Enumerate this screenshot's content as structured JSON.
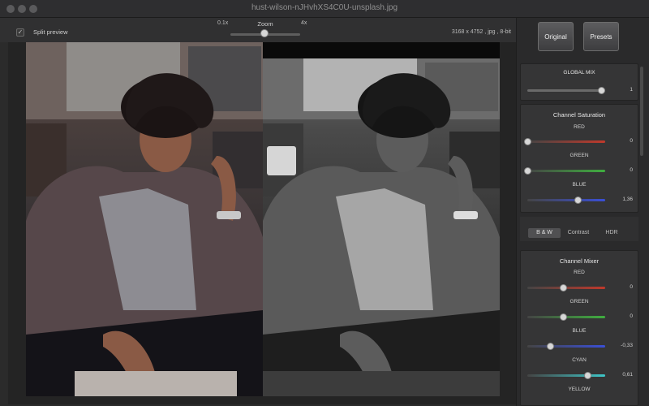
{
  "window": {
    "title": "hust-wilson-nJHvhXS4C0U-unsplash.jpg"
  },
  "toolbar": {
    "split_preview_label": "Split preview",
    "split_preview_checked": true,
    "zoom_label": "Zoom",
    "zoom_min": "0.1x",
    "zoom_max": "4x",
    "image_info": "3168 x 4752 , jpg , 8-bit"
  },
  "sidebar": {
    "original_label": "Original",
    "presets_label": "Presets",
    "global_mix": {
      "title": "GLOBAL MIX",
      "value": "1"
    },
    "channel_saturation": {
      "title": "Channel Saturation",
      "channels": [
        {
          "label": "RED",
          "value": "0"
        },
        {
          "label": "GREEN",
          "value": "0"
        },
        {
          "label": "BLUE",
          "value": "1,36"
        }
      ]
    },
    "modes": [
      "B & W",
      "Contrast",
      "HDR"
    ],
    "channel_mixer": {
      "title": "Channel Mixer",
      "channels": [
        {
          "label": "RED",
          "value": "0"
        },
        {
          "label": "GREEN",
          "value": "0"
        },
        {
          "label": "BLUE",
          "value": "-0,33"
        },
        {
          "label": "CYAN",
          "value": "0,61"
        },
        {
          "label": "YELLOW",
          "value": ""
        }
      ]
    }
  },
  "colors": {
    "red": "#c0392b",
    "green": "#3fae3f",
    "blue": "#3a4fd6",
    "cyan": "#3ec6c8"
  }
}
